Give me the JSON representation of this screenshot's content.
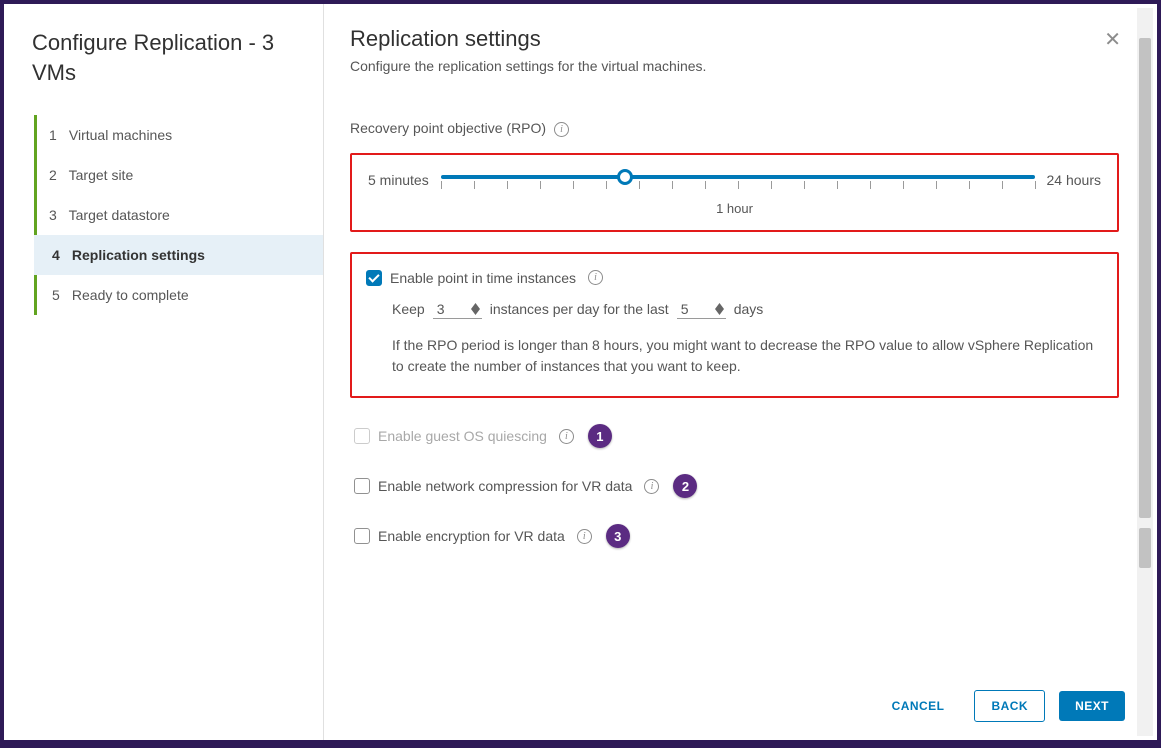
{
  "wizard": {
    "title": "Configure Replication - 3 VMs",
    "steps": [
      {
        "num": "1",
        "label": "Virtual machines"
      },
      {
        "num": "2",
        "label": "Target site"
      },
      {
        "num": "3",
        "label": "Target datastore"
      },
      {
        "num": "4",
        "label": "Replication settings"
      },
      {
        "num": "5",
        "label": "Ready to complete"
      }
    ],
    "current_index": 3
  },
  "page": {
    "title": "Replication settings",
    "subtitle": "Configure the replication settings for the virtual machines."
  },
  "rpo": {
    "label": "Recovery point objective (RPO)",
    "min_label": "5 minutes",
    "max_label": "24 hours",
    "value_label": "1 hour",
    "percent": 31
  },
  "pit": {
    "checkbox_label": "Enable point in time instances",
    "checked": true,
    "keep_prefix": "Keep",
    "keep_value": "3",
    "keep_mid": "instances per day for the last",
    "days_value": "5",
    "keep_suffix": "days",
    "note": "If the RPO period is longer than 8 hours, you might want to decrease the RPO value to allow vSphere Replication to create the number of instances that you want to keep."
  },
  "options": {
    "quiescing": {
      "label": "Enable guest OS quiescing",
      "checked": false,
      "disabled": true,
      "badge": "1"
    },
    "compression": {
      "label": "Enable network compression for VR data",
      "checked": false,
      "disabled": false,
      "badge": "2"
    },
    "encryption": {
      "label": "Enable encryption for VR data",
      "checked": false,
      "disabled": false,
      "badge": "3"
    }
  },
  "footer": {
    "cancel": "CANCEL",
    "back": "BACK",
    "next": "NEXT"
  }
}
